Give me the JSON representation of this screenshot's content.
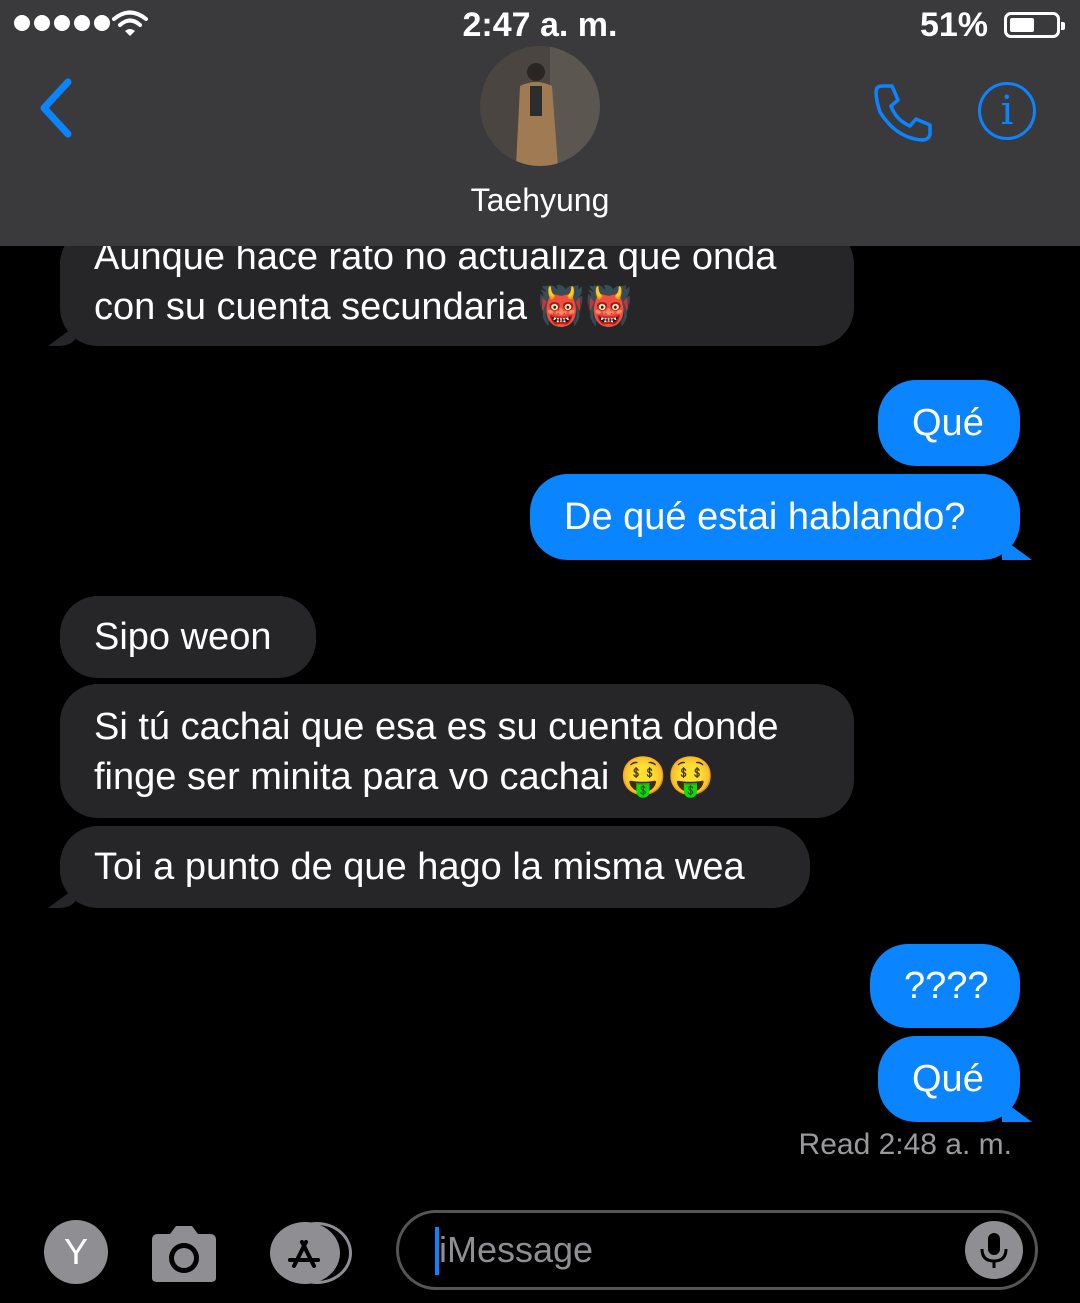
{
  "status_bar": {
    "time": "2:47 a. m.",
    "battery": "51%"
  },
  "header": {
    "contact_name": "Taehyung"
  },
  "messages": [
    {
      "from": "them",
      "lines": [
        "Aunque hace rato no actualiza que onda",
        "con su cuenta secundaria 👹👹"
      ]
    },
    {
      "from": "me",
      "text": "Qué"
    },
    {
      "from": "me",
      "text": "De qué estai hablando?"
    },
    {
      "from": "them",
      "text": "Sipo weon"
    },
    {
      "from": "them",
      "lines": [
        "Si tú cachai que esa es su cuenta donde",
        "finge ser minita para vo cachai 🤑🤑"
      ]
    },
    {
      "from": "them",
      "text": "Toi a punto de que hago la misma wea"
    },
    {
      "from": "me",
      "text": "????"
    },
    {
      "from": "me",
      "text": "Qué"
    }
  ],
  "read_receipt": "Read 2:48 a. m.",
  "composer": {
    "placeholder": "iMessage",
    "avatar_letter": "Y"
  },
  "icons": [
    "back-chevron-icon",
    "phone-icon",
    "info-icon",
    "camera-icon",
    "app-store-icon",
    "microphone-icon"
  ],
  "colors": {
    "accent": "#0a84ff",
    "incoming_bubble": "#262628",
    "header_bg": "#3a3a3c"
  }
}
